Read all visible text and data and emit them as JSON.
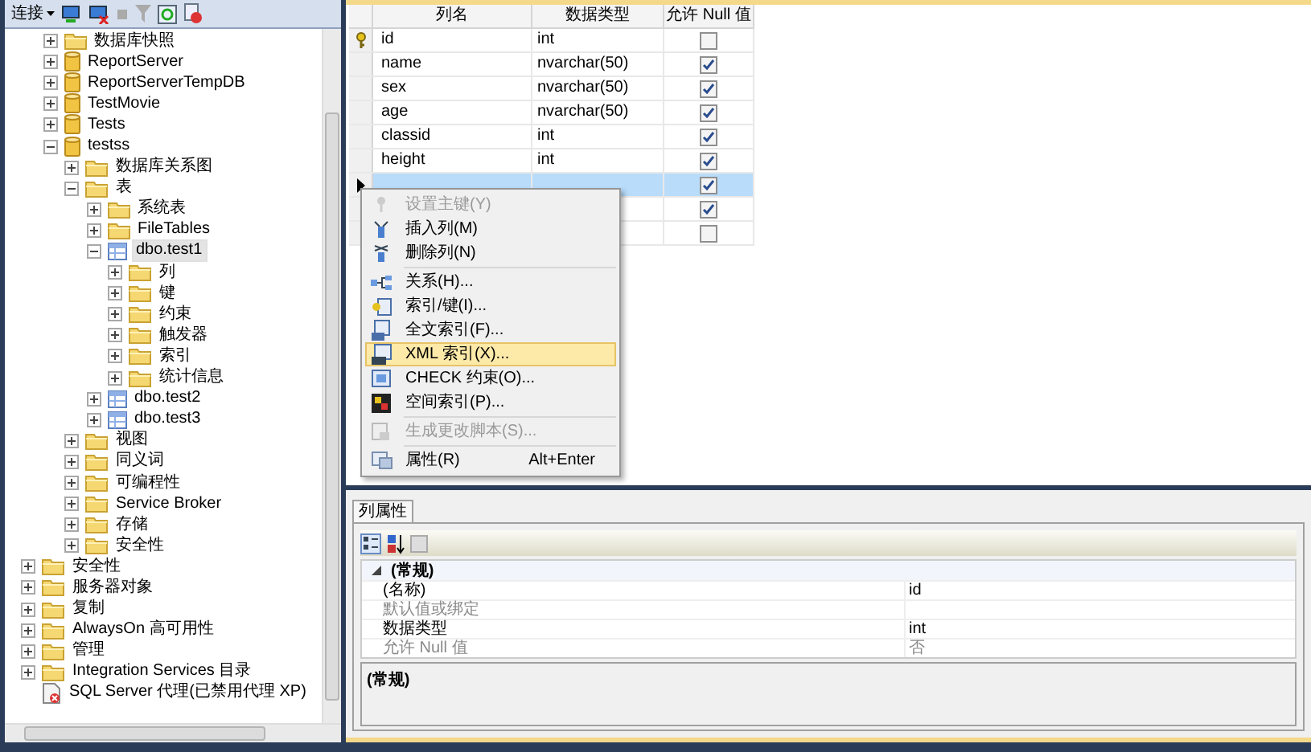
{
  "explorer": {
    "toolbar": {
      "connect": "连接"
    },
    "tree": [
      {
        "children": [
          {
            "label": "数据库快照",
            "kind": "folder",
            "expanded": false,
            "selected": false
          },
          {
            "label": "ReportServer",
            "kind": "database",
            "expanded": false,
            "selected": false
          },
          {
            "label": "ReportServerTempDB",
            "kind": "database",
            "expanded": false,
            "selected": false
          },
          {
            "label": "TestMovie",
            "kind": "database",
            "expanded": false,
            "selected": false
          },
          {
            "label": "Tests",
            "kind": "database",
            "expanded": false,
            "selected": false
          },
          {
            "label": "testss",
            "kind": "database",
            "expanded": true,
            "selected": false,
            "children": [
              {
                "label": "数据库关系图",
                "kind": "folder",
                "expanded": false,
                "selected": false
              },
              {
                "label": "表",
                "kind": "folder",
                "expanded": true,
                "selected": false,
                "children": [
                  {
                    "label": "系统表",
                    "kind": "folder",
                    "expanded": false,
                    "selected": false
                  },
                  {
                    "label": "FileTables",
                    "kind": "folder",
                    "expanded": false,
                    "selected": false
                  },
                  {
                    "label": "dbo.test1",
                    "kind": "table",
                    "expanded": true,
                    "selected": true,
                    "children": [
                      {
                        "label": "列",
                        "kind": "folder",
                        "expanded": false,
                        "selected": false
                      },
                      {
                        "label": "键",
                        "kind": "folder",
                        "expanded": false,
                        "selected": false
                      },
                      {
                        "label": "约束",
                        "kind": "folder",
                        "expanded": false,
                        "selected": false
                      },
                      {
                        "label": "触发器",
                        "kind": "folder",
                        "expanded": false,
                        "selected": false
                      },
                      {
                        "label": "索引",
                        "kind": "folder",
                        "expanded": false,
                        "selected": false
                      },
                      {
                        "label": "统计信息",
                        "kind": "folder",
                        "expanded": false,
                        "selected": false
                      }
                    ]
                  },
                  {
                    "label": "dbo.test2",
                    "kind": "table",
                    "expanded": false,
                    "selected": false
                  },
                  {
                    "label": "dbo.test3",
                    "kind": "table",
                    "expanded": false,
                    "selected": false
                  }
                ]
              },
              {
                "label": "视图",
                "kind": "folder",
                "expanded": false,
                "selected": false
              },
              {
                "label": "同义词",
                "kind": "folder",
                "expanded": false,
                "selected": false
              },
              {
                "label": "可编程性",
                "kind": "folder",
                "expanded": false,
                "selected": false
              },
              {
                "label": "Service Broker",
                "kind": "folder",
                "expanded": false,
                "selected": false
              },
              {
                "label": "存储",
                "kind": "folder",
                "expanded": false,
                "selected": false
              },
              {
                "label": "安全性",
                "kind": "folder",
                "expanded": false,
                "selected": false
              }
            ]
          }
        ]
      },
      {
        "label": "安全性",
        "kind": "folder",
        "expanded": false,
        "selected": false
      },
      {
        "label": "服务器对象",
        "kind": "folder",
        "expanded": false,
        "selected": false
      },
      {
        "label": "复制",
        "kind": "folder",
        "expanded": false,
        "selected": false
      },
      {
        "label": "AlwaysOn 高可用性",
        "kind": "folder",
        "expanded": false,
        "selected": false
      },
      {
        "label": "管理",
        "kind": "folder",
        "expanded": false,
        "selected": false
      },
      {
        "label": "Integration Services 目录",
        "kind": "folder",
        "expanded": false,
        "selected": false
      },
      {
        "label": "SQL Server 代理(已禁用代理 XP)",
        "kind": "agent",
        "selected": false
      }
    ]
  },
  "designer": {
    "columns": [
      "列名",
      "数据类型",
      "允许 Null 值"
    ],
    "rows": [
      {
        "name": "id",
        "type": "int",
        "allow_null": false,
        "primary_key": true,
        "selected": false
      },
      {
        "name": "name",
        "type": "nvarchar(50)",
        "allow_null": true,
        "primary_key": false,
        "selected": false
      },
      {
        "name": "sex",
        "type": "nvarchar(50)",
        "allow_null": true,
        "primary_key": false,
        "selected": false
      },
      {
        "name": "age",
        "type": "nvarchar(50)",
        "allow_null": true,
        "primary_key": false,
        "selected": false
      },
      {
        "name": "classid",
        "type": "int",
        "allow_null": true,
        "primary_key": false,
        "selected": false
      },
      {
        "name": "height",
        "type": "int",
        "allow_null": true,
        "primary_key": false,
        "selected": false
      },
      {
        "allow_null": true,
        "primary_key": false,
        "selected": true
      },
      {
        "allow_null": true,
        "primary_key": false,
        "selected": false
      },
      {
        "allow_null": false,
        "primary_key": false,
        "selected": false
      }
    ]
  },
  "context_menu": [
    {
      "kind": "item",
      "label": "设置主键(Y)",
      "disabled": true,
      "selected": false
    },
    {
      "kind": "item",
      "label": "插入列(M)",
      "disabled": false,
      "selected": false
    },
    {
      "kind": "item",
      "label": "删除列(N)",
      "disabled": false,
      "selected": false
    },
    {
      "kind": "separator"
    },
    {
      "kind": "item",
      "label": "关系(H)...",
      "disabled": false,
      "selected": false
    },
    {
      "kind": "item",
      "label": "索引/键(I)...",
      "disabled": false,
      "selected": false
    },
    {
      "kind": "item",
      "label": "全文索引(F)...",
      "disabled": false,
      "selected": false
    },
    {
      "kind": "item",
      "label": "XML 索引(X)...",
      "disabled": false,
      "selected": true
    },
    {
      "kind": "item",
      "label": "CHECK 约束(O)...",
      "disabled": false,
      "selected": false
    },
    {
      "kind": "item",
      "label": "空间索引(P)...",
      "disabled": false,
      "selected": false
    },
    {
      "kind": "separator"
    },
    {
      "kind": "item",
      "label": "生成更改脚本(S)...",
      "disabled": true,
      "selected": false
    },
    {
      "kind": "separator"
    },
    {
      "kind": "item",
      "label": "属性(R)",
      "shortcut": "Alt+Enter",
      "disabled": false,
      "selected": false
    }
  ],
  "properties": {
    "tab": "列属性",
    "category": {
      "label": "(常规)",
      "expanded": true
    },
    "rows": [
      {
        "name": "(名称)",
        "value": "id",
        "disabled": false
      },
      {
        "name": "默认值或绑定",
        "disabled": true
      },
      {
        "name": "数据类型",
        "value": "int",
        "disabled": false
      },
      {
        "name": "允许 Null 值",
        "value": "否",
        "disabled": true
      }
    ],
    "description": "(常规)"
  }
}
